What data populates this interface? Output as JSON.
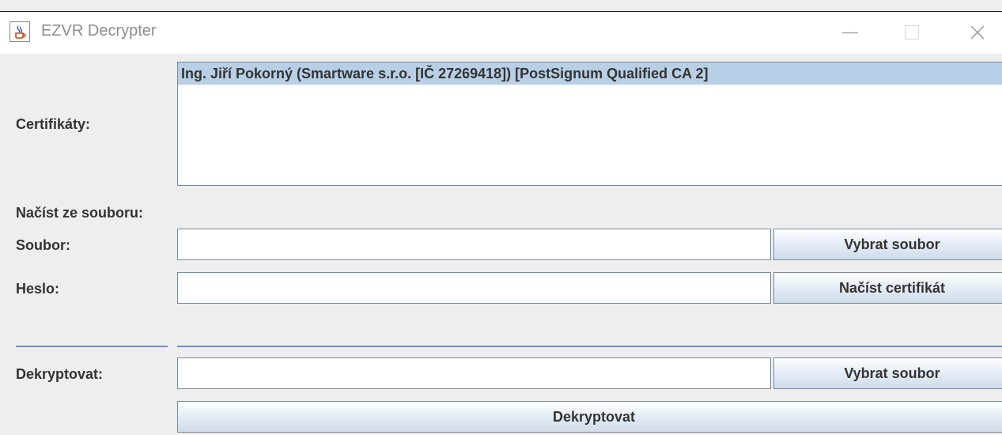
{
  "window": {
    "title": "EZVR Decrypter",
    "icon": "java-cup-icon",
    "controls": [
      "minimize-icon",
      "maximize-icon",
      "close-icon"
    ]
  },
  "certificates": {
    "label": "Certifikáty:",
    "items": [
      "Ing. Jiří Pokorný (Smartware s.r.o. [IČ 27269418]) [PostSignum Qualified CA 2]"
    ],
    "selected_index": 0,
    "selection_color": "#b8cfe5"
  },
  "load_from_file": {
    "section_label": "Načíst ze souboru:",
    "file_label": "Soubor:",
    "file_value": "",
    "select_file_button": "Vybrat soubor",
    "password_label": "Heslo:",
    "password_value": "",
    "load_certificate_button": "Načíst certifikát"
  },
  "decrypt": {
    "label": "Dekryptovat:",
    "file_value": "",
    "select_file_button": "Vybrat soubor",
    "decrypt_button": "Dekryptovat"
  },
  "colors": {
    "separator": "#6b8fd1",
    "background": "#eeeeee"
  }
}
